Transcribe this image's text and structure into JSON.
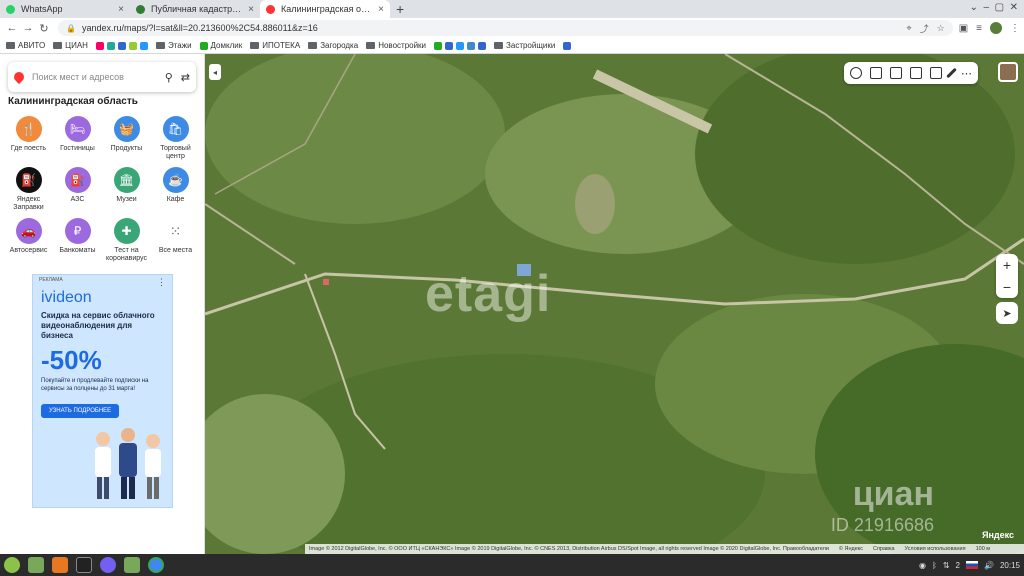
{
  "browser": {
    "tabs": [
      {
        "title": "WhatsApp",
        "color": "#25d366"
      },
      {
        "title": "Публичная кадастровая карта",
        "color": "#2e7d32"
      },
      {
        "title": "Калининградская область",
        "color": "#f33"
      }
    ],
    "url": "yandex.ru/maps/?l=sat&ll=20.213600%2C54.886011&z=16",
    "bookmarks": [
      "АВИТО",
      "ЦИАН",
      "Этажи",
      "Домклик",
      "ИПОТЕКА",
      "Загородка",
      "Новостройки",
      "Застройщики"
    ]
  },
  "sidebar": {
    "search_placeholder": "Поиск мест и адресов",
    "region": "Калининградская область",
    "categories": [
      {
        "label": "Где поесть",
        "color": "#f08a3c",
        "icon": "fork-icon"
      },
      {
        "label": "Гостиницы",
        "color": "#9c6ade",
        "icon": "bed-icon"
      },
      {
        "label": "Продукты",
        "color": "#3d8be5",
        "icon": "basket-icon"
      },
      {
        "label": "Торговый центр",
        "color": "#3d8be5",
        "icon": "bag-icon"
      },
      {
        "label": "Яндекс Заправки",
        "color": "#111111",
        "icon": "fuel-icon"
      },
      {
        "label": "АЗС",
        "color": "#9c6ade",
        "icon": "gas-icon"
      },
      {
        "label": "Музеи",
        "color": "#3aa678",
        "icon": "museum-icon"
      },
      {
        "label": "Кафе",
        "color": "#3d8be5",
        "icon": "cup-icon"
      },
      {
        "label": "Автосервис",
        "color": "#9c6ade",
        "icon": "car-icon"
      },
      {
        "label": "Банкоматы",
        "color": "#9c6ade",
        "icon": "ruble-icon"
      },
      {
        "label": "Тест на коронавирус",
        "color": "#3aa678",
        "icon": "plus-icon"
      },
      {
        "label": "Все места",
        "color": "#ffffff",
        "icon": "grid-icon"
      }
    ]
  },
  "ad": {
    "tag": "РЕКЛАМА",
    "brand": "ivideon",
    "headline": "Скидка на сервис облачного видеонаблюдения для бизнеса",
    "discount": "-50%",
    "body": "Покупайте и продлевайте подписки на сервисы за полцены до 31 марта!",
    "cta": "УЗНАТЬ ПОДРОБНЕЕ"
  },
  "map": {
    "watermark": "etagi",
    "cian": "циан",
    "cian_id": "ID 21916686",
    "logo": "Яндекс",
    "copyright": "Image © 2012 DigitalGlobe, Inc. © ООО ИТЦ «СКАНЭКС» Image © 2019 DigitalGlobe, Inc. © CNES 2013, Distribution Airbus DS/Spot Image, all rights reserved Image © 2020 DigitalGlobe, Inc. Правообладатели",
    "footer_links": [
      "© Яндекс",
      "Справка",
      "Условия использования"
    ],
    "scale": "100 м"
  },
  "taskbar": {
    "time": "20:15",
    "badge": "2"
  }
}
